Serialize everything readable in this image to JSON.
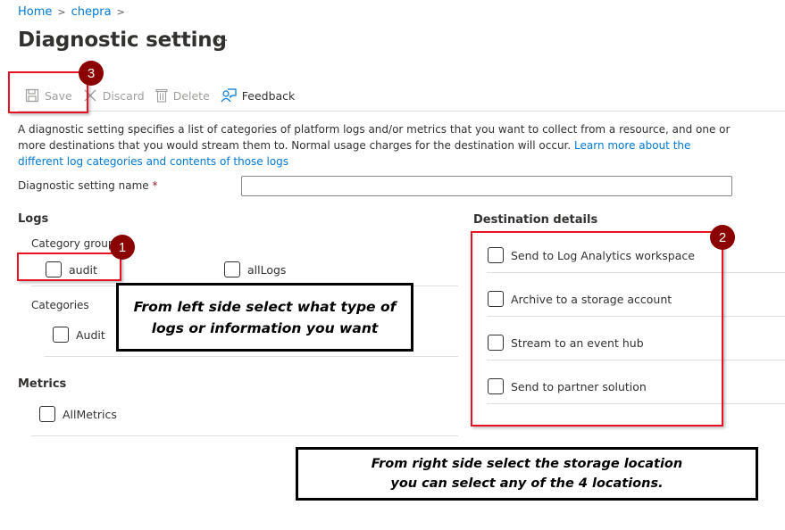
{
  "breadcrumb": {
    "items": [
      "Home",
      "chepra"
    ],
    "separator": ">"
  },
  "header": {
    "title": "Diagnostic setting",
    "more_label": "···"
  },
  "toolbar": {
    "save_label": "Save",
    "discard_label": "Discard",
    "delete_label": "Delete",
    "feedback_label": "Feedback"
  },
  "description": {
    "text": "A diagnostic setting specifies a list of categories of platform logs and/or metrics that you want to collect from a resource, and one or more destinations that you would stream them to. Normal usage charges for the destination will occur. ",
    "link_text": "Learn more about the different log categories and contents of those logs"
  },
  "name_field": {
    "label": "Diagnostic setting name",
    "required_marker": "*",
    "value": ""
  },
  "logs": {
    "heading": "Logs",
    "category_groups_label": "Category groups",
    "category_groups": [
      {
        "label": "audit",
        "checked": false
      },
      {
        "label": "allLogs",
        "checked": false
      }
    ],
    "categories_label": "Categories",
    "categories": [
      {
        "label": "Audit",
        "checked": false
      }
    ]
  },
  "metrics": {
    "heading": "Metrics",
    "items": [
      {
        "label": "AllMetrics",
        "checked": false
      }
    ]
  },
  "destination": {
    "heading": "Destination details",
    "items": [
      {
        "label": "Send to Log Analytics workspace",
        "checked": false
      },
      {
        "label": "Archive to a storage account",
        "checked": false
      },
      {
        "label": "Stream to an event hub",
        "checked": false
      },
      {
        "label": "Send to partner solution",
        "checked": false
      }
    ]
  },
  "annotations": {
    "badges": [
      "1",
      "2",
      "3"
    ],
    "callout_left": "From left side select what type of logs or information you want",
    "callout_left_lines": [
      "From left side select what type of",
      "logs or information you want"
    ],
    "callout_right_lines": [
      "From right side select the storage location",
      "you can select any of the 4 locations."
    ],
    "highlight_color": "#e81123",
    "badge_color": "#8b0000"
  },
  "colors": {
    "link": "#0078d4",
    "text": "#323130",
    "disabled": "#a19f9d",
    "divider": "#e1dfdd"
  }
}
